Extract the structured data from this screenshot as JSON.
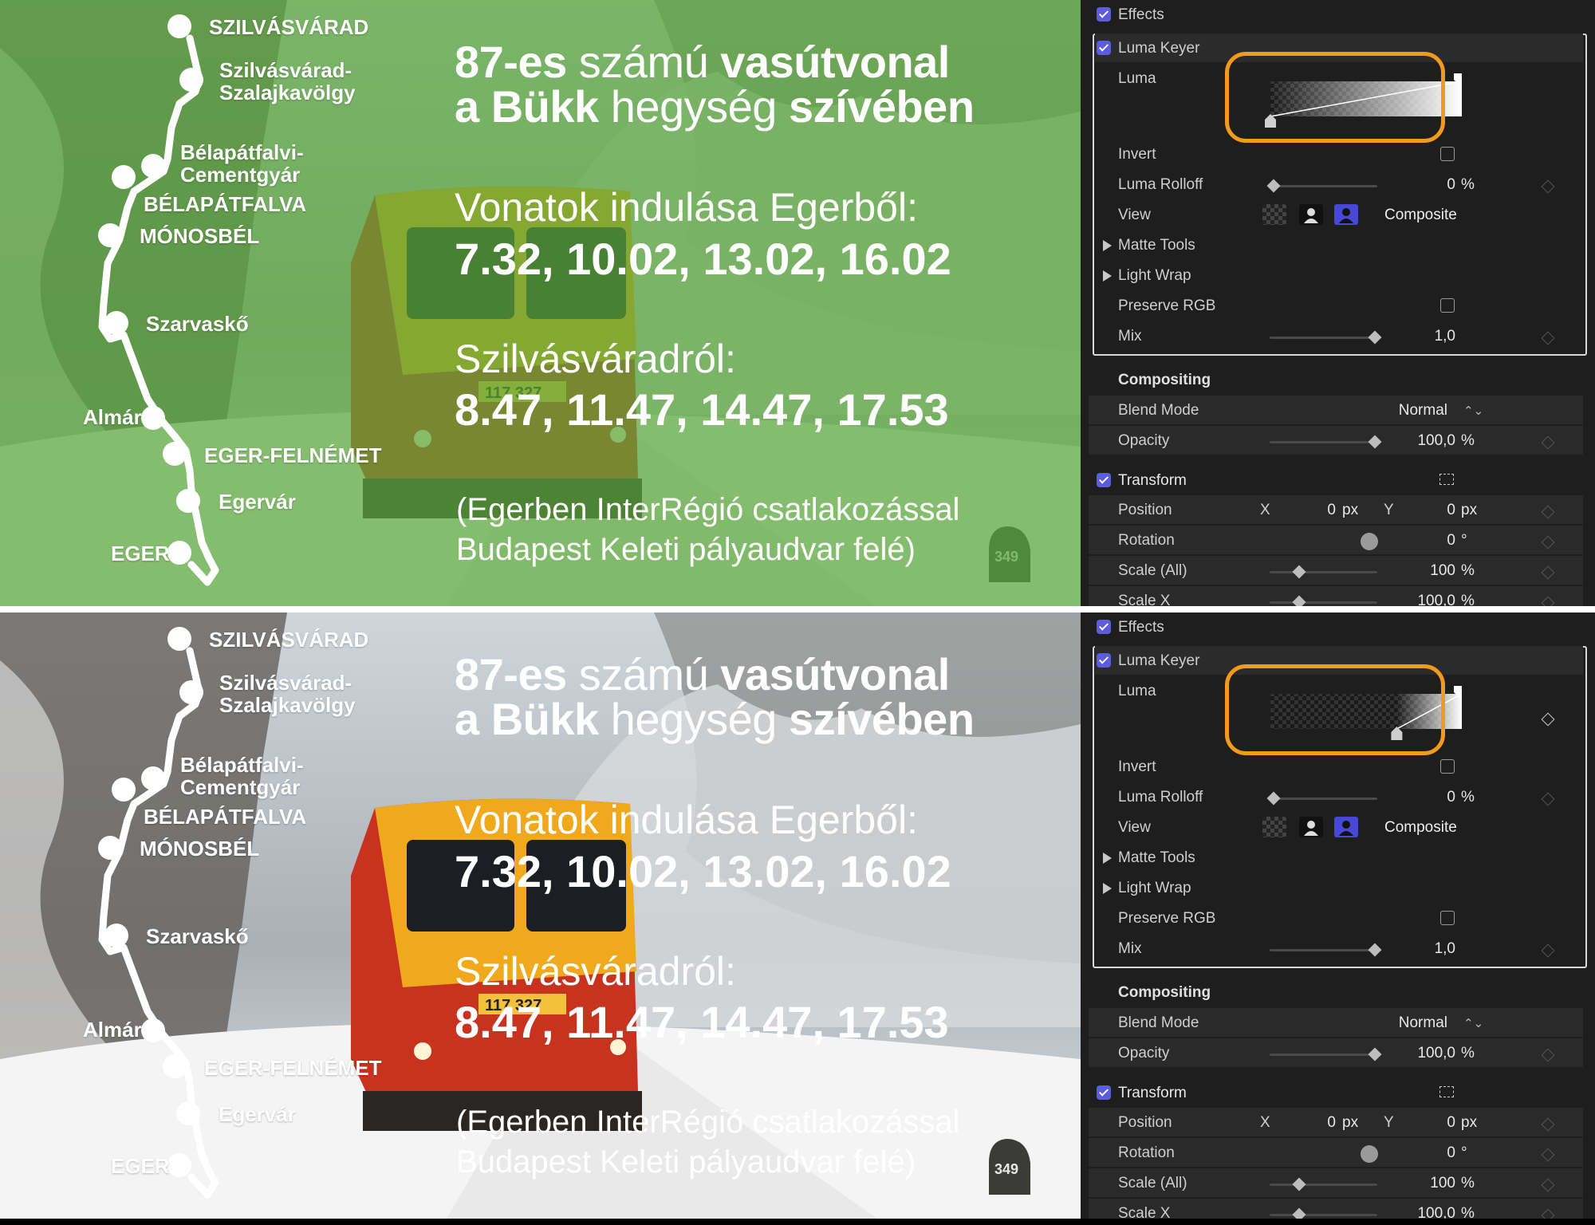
{
  "overlay": {
    "title_line1": [
      "87-es",
      " számú ",
      "vasútvonal"
    ],
    "title_line2": [
      "a Bükk",
      " hegység ",
      "szívében"
    ],
    "departures_from_eger_label": "Vonatok indulása Egerből:",
    "departures_from_eger_times": "7.32, 10.02, 13.02, 16.02",
    "departures_from_szilvasvarad_label": "Szilvásváradról:",
    "departures_from_szilvasvarad_times": "8.47, 11.47, 14.47, 17.53",
    "note_line1": "(Egerben InterRégió csatlakozással",
    "note_line2": "Budapest Keleti pályaudvar felé)",
    "train_number": "117 327",
    "milestone": "349"
  },
  "stations": [
    {
      "id": "szilvasvarad",
      "label": [
        "SZILVÁSVÁRAD"
      ]
    },
    {
      "id": "szilvasvarad-szalajkavolgy",
      "label": [
        "Szilvásvárad-",
        "Szalajkavölgy"
      ]
    },
    {
      "id": "belapatfalvi-cementgyar",
      "label": [
        "Bélapátfalvi-",
        "Cementgyár"
      ]
    },
    {
      "id": "belapatfalva",
      "label": [
        "BÉLAPÁTFALVA"
      ]
    },
    {
      "id": "monosbel",
      "label": [
        "MÓNOSBÉL"
      ]
    },
    {
      "id": "szarvasko",
      "label": [
        "Szarvaskő"
      ]
    },
    {
      "id": "almar",
      "label": [
        "Almár"
      ]
    },
    {
      "id": "eger-felnemet",
      "label": [
        "EGER-FELNÉMET"
      ]
    },
    {
      "id": "egervar",
      "label": [
        "Egervár"
      ]
    },
    {
      "id": "eger",
      "label": [
        "EGER"
      ]
    }
  ],
  "inspector": {
    "effects_label": "Effects",
    "luma_keyer_label": "Luma Keyer",
    "luma_label": "Luma",
    "invert_label": "Invert",
    "luma_rolloff_label": "Luma Rolloff",
    "luma_rolloff_value": "0",
    "luma_rolloff_unit": "%",
    "view_label": "View",
    "view_mode": "Composite",
    "matte_tools_label": "Matte Tools",
    "light_wrap_label": "Light Wrap",
    "preserve_rgb_label": "Preserve RGB",
    "mix_label": "Mix",
    "mix_value": "1,0",
    "compositing_label": "Compositing",
    "blend_mode_label": "Blend Mode",
    "blend_mode_value": "Normal",
    "opacity_label": "Opacity",
    "opacity_value": "100,0",
    "opacity_unit": "%",
    "transform_label": "Transform",
    "position_label": "Position",
    "x_label": "X",
    "x_value": "0",
    "y_label": "Y",
    "y_value": "0",
    "px_unit": "px",
    "rotation_label": "Rotation",
    "rotation_value": "0",
    "rotation_unit": "°",
    "scale_all_label": "Scale (All)",
    "scale_all_value": "100",
    "scale_unit": "%",
    "scale_x_label": "Scale X",
    "scale_x_value": "100,0",
    "scale_x_unit": "%"
  },
  "panels": [
    {
      "id": "top",
      "tint": "#5aa83c",
      "luma_black_point": 0.0
    },
    {
      "id": "bottom",
      "tint": "none",
      "luma_black_point": 0.66
    }
  ],
  "colors": {
    "checkbox_accent": "#5b5ce0",
    "highlight_orange": "#f39a1e",
    "panel_background": "#1e1e1e"
  }
}
